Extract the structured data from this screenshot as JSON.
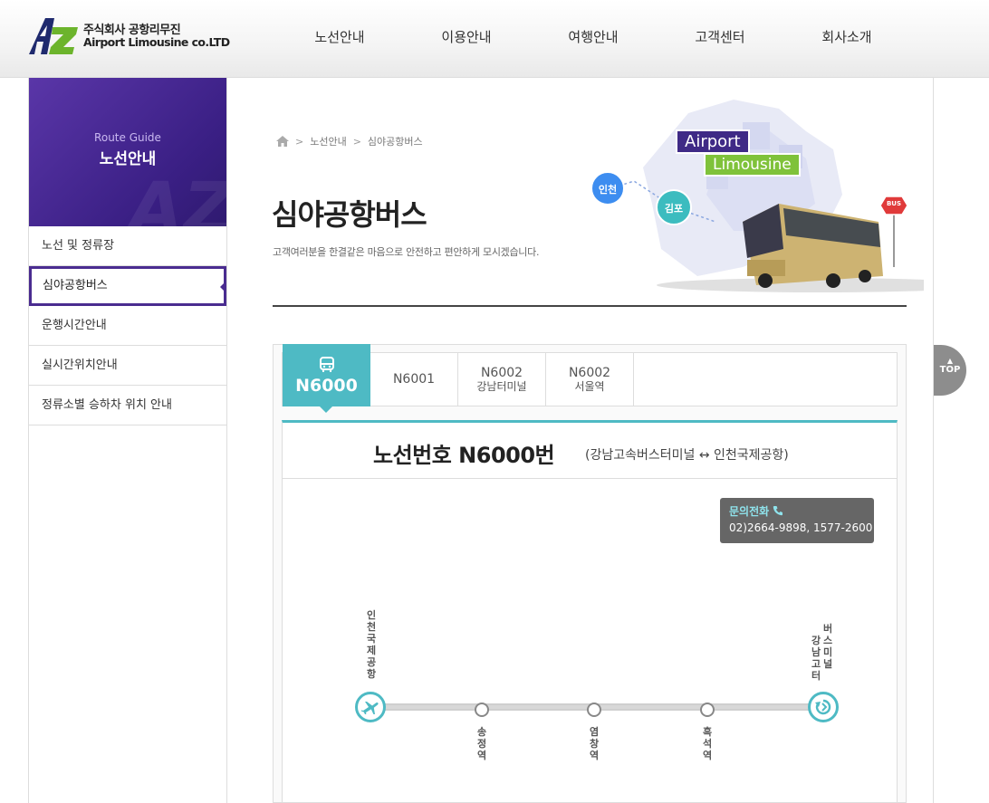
{
  "header": {
    "logo_ko": "주식회사 공항리무진",
    "logo_en": "Airport Limousine co.LTD",
    "nav": [
      "노선안내",
      "이용안내",
      "여행안내",
      "고객센터",
      "회사소개"
    ]
  },
  "sidebar": {
    "hero_en": "Route Guide",
    "hero_ko": "노선안내",
    "items": [
      "노선 및 정류장",
      "심야공항버스",
      "운행시간안내",
      "실시간위치안내",
      "정류소별 승하차 위치 안내"
    ],
    "active_index": 1
  },
  "breadcrumb": [
    "노선안내",
    "심야공항버스"
  ],
  "page": {
    "title": "심야공항버스",
    "desc": "고객여러분을 한결같은 마음으로 안전하고 편안하게 모시겠습니다."
  },
  "hero": {
    "tag1": "Airport",
    "tag2": "Limousine",
    "bubble1": "인천",
    "bubble2": "김포",
    "bus_sign": "BUS"
  },
  "tabs": [
    {
      "name": "N6000",
      "sub": "",
      "active": true
    },
    {
      "name": "N6001",
      "sub": "",
      "active": false
    },
    {
      "name": "N6002",
      "sub": "강남터미널",
      "active": false
    },
    {
      "name": "N6002",
      "sub": "서울역",
      "active": false
    }
  ],
  "route": {
    "title": "노선번호 N6000번",
    "subtitle": "(강남고속버스터미널 ↔ 인천국제공항)",
    "phone_label": "문의전화",
    "phone_numbers": "02)2664-9898, 1577-2600",
    "start": "인천국제공항",
    "end_col1": "강남고터",
    "end_col2": "버스미널",
    "stops": [
      "송정역",
      "염창역",
      "흑석역"
    ]
  },
  "top_button": "TOP",
  "colors": {
    "purple": "#3f2a86",
    "teal": "#4ebac4",
    "green": "#7fc23a"
  }
}
